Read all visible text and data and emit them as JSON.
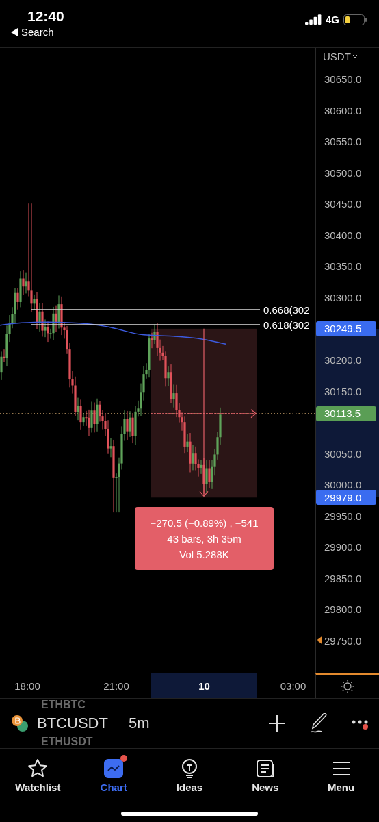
{
  "status_bar": {
    "time": "12:40",
    "back_link": "Search",
    "network": "4G"
  },
  "chart": {
    "currency": "USDT",
    "price_labels": [
      {
        "label": "30650.0",
        "alert": false
      },
      {
        "label": "30600.0",
        "alert": false
      },
      {
        "label": "30550.0",
        "alert": false
      },
      {
        "label": "30500.0",
        "alert": false
      },
      {
        "label": "30450.0",
        "alert": false
      },
      {
        "label": "30400.0",
        "alert": false
      },
      {
        "label": "30350.0",
        "alert": false
      },
      {
        "label": "30300.0",
        "alert": false
      },
      {
        "label": "30200.0",
        "alert": false
      },
      {
        "label": "30150.0",
        "alert": false
      },
      {
        "label": "30050.0",
        "alert": false
      },
      {
        "label": "30000.0",
        "alert": false
      },
      {
        "label": "29950.0",
        "alert": false
      },
      {
        "label": "29900.0",
        "alert": false
      },
      {
        "label": "29850.0",
        "alert": false
      },
      {
        "label": "29800.0",
        "alert": false
      },
      {
        "label": "29750.0",
        "alert": true
      }
    ],
    "badges": [
      {
        "label": "30249.5",
        "color": "#3a6cf0"
      },
      {
        "label": "30113.5",
        "color": "#5a9e55"
      },
      {
        "label": "29979.0",
        "color": "#3a6cf0"
      }
    ],
    "fib_levels": [
      {
        "label": "0.668(302"
      },
      {
        "label": "0.618(302"
      }
    ],
    "measure": {
      "lines": [
        "−270.5 (−0.89%) , −541",
        "43 bars, 3h 35m",
        "Vol 5.288K"
      ]
    },
    "time_labels": [
      {
        "label": "18:00",
        "selected": false
      },
      {
        "label": "21:00",
        "selected": false
      },
      {
        "label": "10",
        "selected": true
      },
      {
        "label": "03:00",
        "selected": false
      }
    ]
  },
  "symbol_bar": {
    "symbol": "BTCUSDT",
    "interval": "5m",
    "ghost_above": "ETHBTC",
    "ghost_below": "ETHUSDT"
  },
  "tabs": [
    {
      "label": "Watchlist",
      "selected": false,
      "notification": false
    },
    {
      "label": "Chart",
      "selected": true,
      "notification": true
    },
    {
      "label": "Ideas",
      "selected": false,
      "notification": false
    },
    {
      "label": "News",
      "selected": false,
      "notification": false
    },
    {
      "label": "Menu",
      "selected": false,
      "notification": false
    }
  ]
}
